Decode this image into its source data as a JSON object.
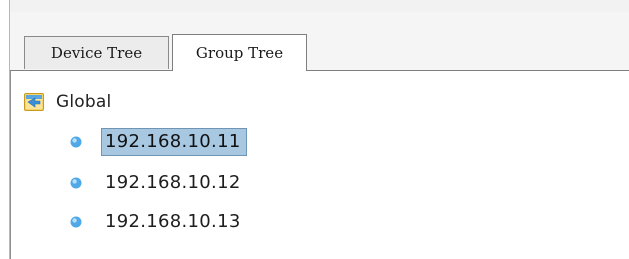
{
  "tabs": [
    {
      "label": "Device Tree",
      "active": false
    },
    {
      "label": "Group Tree",
      "active": true
    }
  ],
  "tree": {
    "root": {
      "label": "Global",
      "icon": "folder-icon"
    },
    "nodes": [
      {
        "label": "192.168.10.11",
        "icon": "device-dot-icon",
        "selected": true
      },
      {
        "label": "192.168.10.12",
        "icon": "device-dot-icon",
        "selected": false
      },
      {
        "label": "192.168.10.13",
        "icon": "device-dot-icon",
        "selected": false
      }
    ]
  },
  "colors": {
    "selection_bg": "#a8c8e2",
    "selection_border": "#6f94b4",
    "dot": "#4fa8e8",
    "folder": "#f2c24a"
  }
}
